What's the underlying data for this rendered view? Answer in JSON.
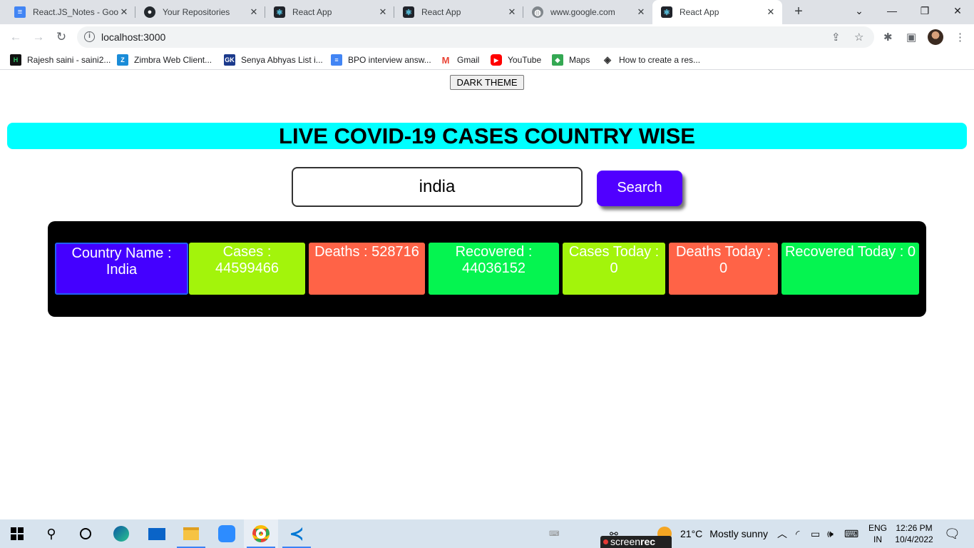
{
  "browser": {
    "tabs": [
      {
        "title": "React.JS_Notes - Goog",
        "icon": "google-docs-icon"
      },
      {
        "title": "Your Repositories",
        "icon": "github-icon"
      },
      {
        "title": "React App",
        "icon": "react-icon"
      },
      {
        "title": "React App",
        "icon": "react-icon"
      },
      {
        "title": "www.google.com",
        "icon": "globe-icon"
      },
      {
        "title": "React App",
        "icon": "react-icon"
      }
    ],
    "address": "localhost:3000",
    "bookmarks": [
      {
        "label": "Rajesh saini - saini2...",
        "icon": "hackerrank-icon"
      },
      {
        "label": "Zimbra Web Client...",
        "icon": "zimbra-icon"
      },
      {
        "label": "Senya Abhyas List i...",
        "icon": "gk-icon"
      },
      {
        "label": "BPO interview answ...",
        "icon": "google-docs-icon"
      },
      {
        "label": "Gmail",
        "icon": "gmail-icon"
      },
      {
        "label": "YouTube",
        "icon": "youtube-icon"
      },
      {
        "label": "Maps",
        "icon": "maps-icon"
      },
      {
        "label": "How to create a res...",
        "icon": "codepen-icon"
      }
    ]
  },
  "page": {
    "theme_button": "DARK THEME",
    "heading": "LIVE COVID-19 CASES COUNTRY WISE",
    "search_value": "india",
    "search_button": "Search",
    "stats": [
      {
        "label": "Country Name :",
        "value": "India",
        "color": "#4400ff"
      },
      {
        "label": "Cases :",
        "value": "44599466",
        "color": "#a3f40b"
      },
      {
        "label": "Deaths :",
        "value": "528716",
        "color": "#ff6347"
      },
      {
        "label": "Recovered :",
        "value": "44036152",
        "color": "#05f450"
      },
      {
        "label": "Cases Today :",
        "value": "0",
        "color": "#a3f40b"
      },
      {
        "label": "Deaths Today :",
        "value": "0",
        "color": "#ff6347"
      },
      {
        "label": "Recovered Today :",
        "value": "0",
        "color": "#05f450"
      }
    ]
  },
  "taskbar": {
    "weather": {
      "temp": "21°C",
      "desc": "Mostly sunny"
    },
    "language": {
      "line1": "ENG",
      "line2": "IN"
    },
    "clock": {
      "time": "12:26 PM",
      "date": "10/4/2022"
    },
    "recorder": {
      "brand": "screen",
      "brand_bold": "rec"
    }
  }
}
